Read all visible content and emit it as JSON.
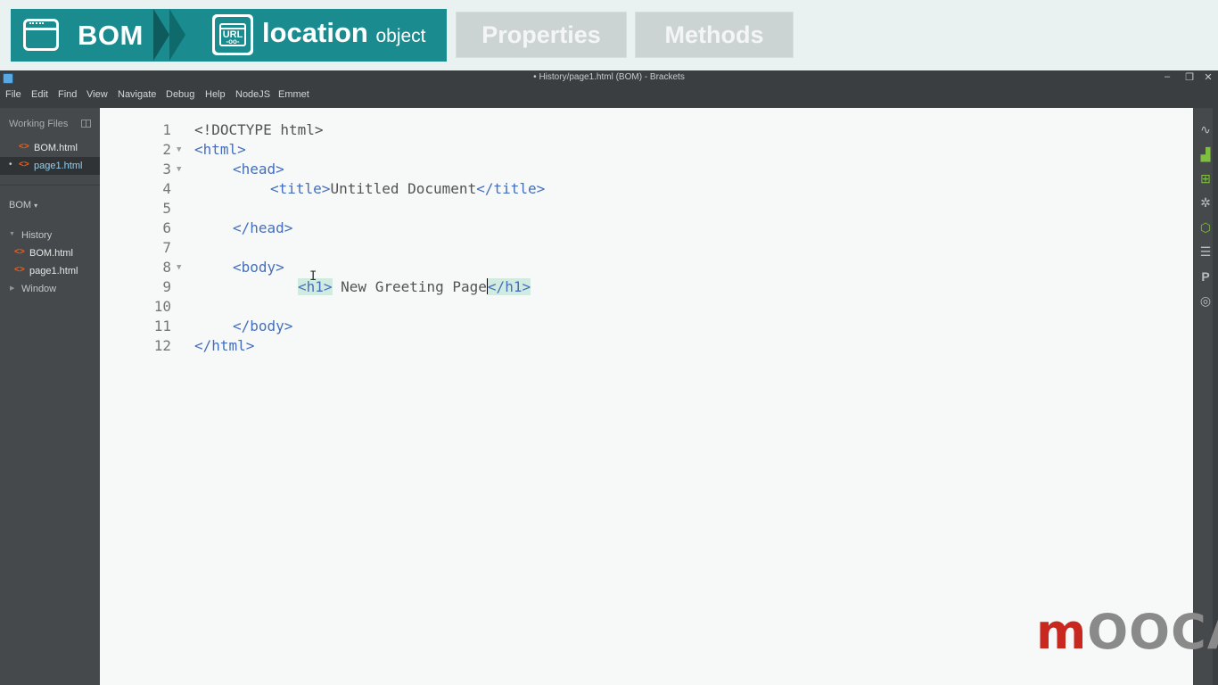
{
  "banner": {
    "bom_label": "BOM",
    "location_label": "location",
    "location_sub": "object",
    "url_icon_text": "URL",
    "tabs": {
      "properties": "Properties",
      "methods": "Methods"
    },
    "colors": {
      "accent": "#1a8c8f",
      "tab_inactive": "#ccd3d3"
    }
  },
  "window": {
    "title": "• History/page1.html (BOM) - Brackets",
    "controls": {
      "minimize": "–",
      "maximize": "❐",
      "close": "✕"
    }
  },
  "menu": [
    "File",
    "Edit",
    "Find",
    "View",
    "Navigate",
    "Debug",
    "Help",
    "NodeJS",
    "Emmet"
  ],
  "sidebar": {
    "working_files_title": "Working Files",
    "working_files": [
      {
        "name": "BOM.html",
        "modified": false,
        "selected": false
      },
      {
        "name": "page1.html",
        "modified": true,
        "selected": true
      }
    ],
    "project_title": "BOM",
    "project_caret": "▾",
    "tree": [
      {
        "label": "History",
        "expanded": true
      },
      {
        "label": "BOM.html"
      },
      {
        "label": "page1.html"
      },
      {
        "label": "Window",
        "expanded": false
      }
    ],
    "modified_dot": "•",
    "icons": {
      "file": "html-tag-icon",
      "split": "split-view-icon"
    }
  },
  "editor": {
    "line_numbers": [
      "1",
      "2",
      "3",
      "4",
      "5",
      "6",
      "7",
      "8",
      "9",
      "10",
      "11",
      "12"
    ],
    "lines": {
      "l1": "<!DOCTYPE html>",
      "l2": "<html>",
      "l3": "<head>",
      "l4_open": "<title>",
      "l4_text": "Untitled Document",
      "l4_close": "</title>",
      "l6": "</head>",
      "l8": "<body>",
      "l9_open": "<h1>",
      "l9_text": " New Greeting Page",
      "l9_close": "</h1>",
      "l11": "</body>",
      "l12": "</html>"
    },
    "colors": {
      "tag": "#446fbd",
      "text": "#535353",
      "bracket_match": "#d2ebe0"
    }
  },
  "right_toolbar": {
    "icons": [
      "live-preview-icon",
      "extension-manager-icon",
      "gift-icon",
      "wand-icon",
      "nodejs-icon",
      "list-icon",
      "p-icon",
      "lightbulb-icon"
    ]
  },
  "watermark": {
    "red": "m",
    "gray": "OOCA"
  }
}
